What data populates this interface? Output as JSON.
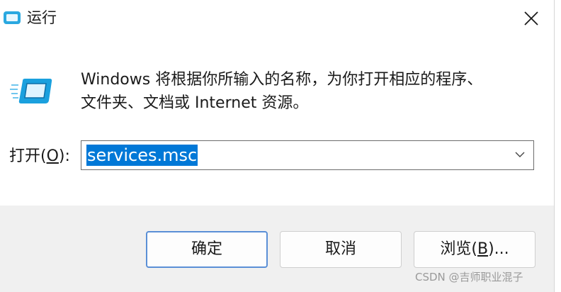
{
  "window": {
    "title": "运行",
    "close_label": "close"
  },
  "body": {
    "description_line1": "Windows 将根据你所输入的名称，为你打开相应的程序、",
    "description_line2": "文件夹、文档或 Internet 资源。"
  },
  "open_field": {
    "label_prefix": "打开(",
    "label_accel": "O",
    "label_suffix": "):",
    "value": "services.msc"
  },
  "buttons": {
    "ok": "确定",
    "cancel": "取消",
    "browse_prefix": "浏览(",
    "browse_accel": "B",
    "browse_suffix": ")..."
  },
  "watermark": "CSDN @吉师职业混子",
  "icons": {
    "title": "run-app-icon",
    "main": "run-icon",
    "close": "close-icon",
    "dropdown": "chevron-down-icon"
  },
  "colors": {
    "selection": "#0078d7",
    "footer_bg": "#f0f0f0",
    "primary_border": "#5a8fd6"
  }
}
